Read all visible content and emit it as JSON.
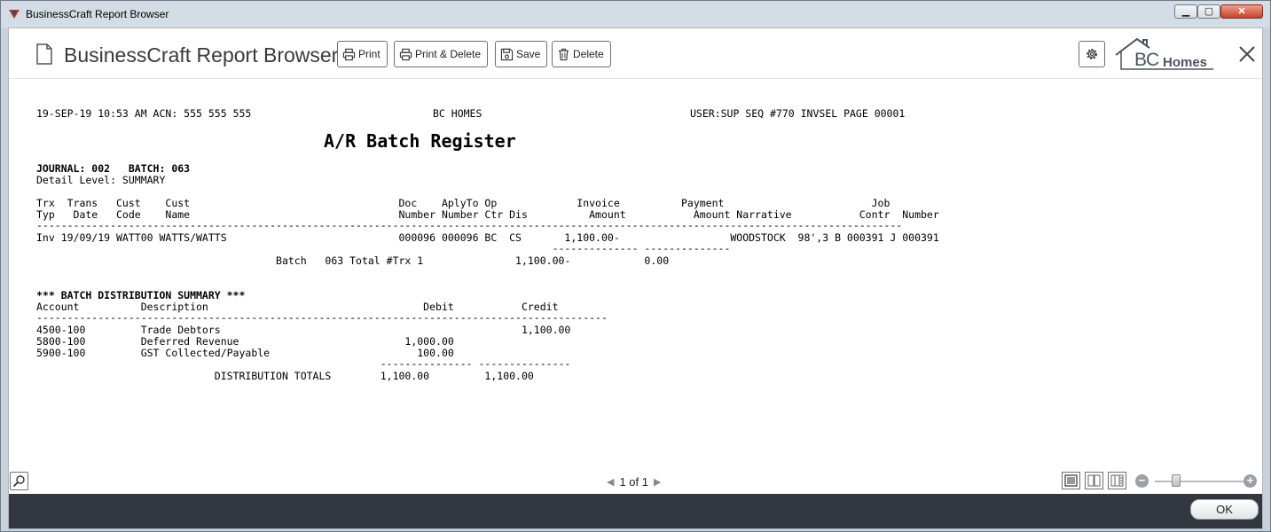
{
  "window": {
    "title": "BusinessCraft Report Browser",
    "controls": {
      "minimize": "▁",
      "maximize": "▢",
      "close": "✕"
    }
  },
  "header": {
    "title": "BusinessCraft Report Browser",
    "buttons": {
      "print": "Print",
      "print_delete": "Print & Delete",
      "save": "Save",
      "delete": "Delete"
    },
    "logo": {
      "bc": "BC",
      "homes": "Homes"
    },
    "icons": [
      "document-icon",
      "printer-icon",
      "save-icon",
      "trash-icon",
      "gear-icon",
      "close-icon"
    ]
  },
  "report": {
    "header_left": "19-SEP-19 10:53 AM ACN: 555 555 555",
    "header_center": "BC HOMES",
    "header_right": "USER:SUP SEQ #770 INVSEL PAGE 00001",
    "title": "A/R Batch Register",
    "journal_line": "JOURNAL: 002   BATCH: 063",
    "detail_level": "Detail Level: SUMMARY",
    "columns_line1": "Trx  Trans   Cust    Cust                                  Doc    AplyTo Op             Invoice          Payment                        Job",
    "columns_line2": "Typ   Date   Code    Name                                  Number Number Ctr Dis          Amount           Amount Narrative           Contr  Number",
    "dashes1": "---------------------------------------------------------------------------------------------------------------------------------------------",
    "row1": "Inv 19/09/19 WATT00 WATTS/WATTS                            000096 000096 BC  CS       1,100.00-                  WOODSTOCK  98',3 B 000391 J 000391",
    "dashes2": "                                                                                    -------------- --------------",
    "batch_total": "                                       Batch   063 Total #Trx 1               1,100.00-            0.00",
    "dist_header": "*** BATCH DISTRIBUTION SUMMARY ***",
    "dist_columns": "Account          Description                                   Debit           Credit",
    "dashes3": "---------------------------------------------------------------------------------------------",
    "dist_row1": "4500-100         Trade Debtors                                                 1,100.00",
    "dist_row2": "5800-100         Deferred Revenue                           1,000.00",
    "dist_row3": "5900-100         GST Collected/Payable                        100.00",
    "dashes4": "                                                        --------------- ---------------",
    "dist_totals": "                             DISTRIBUTION TOTALS        1,100.00         1,100.00"
  },
  "bottom": {
    "pager_text": "1 of 1",
    "prev": "◀",
    "next": "▶",
    "zoom_minus": "−",
    "zoom_plus": "+"
  },
  "footer": {
    "ok": "OK"
  }
}
